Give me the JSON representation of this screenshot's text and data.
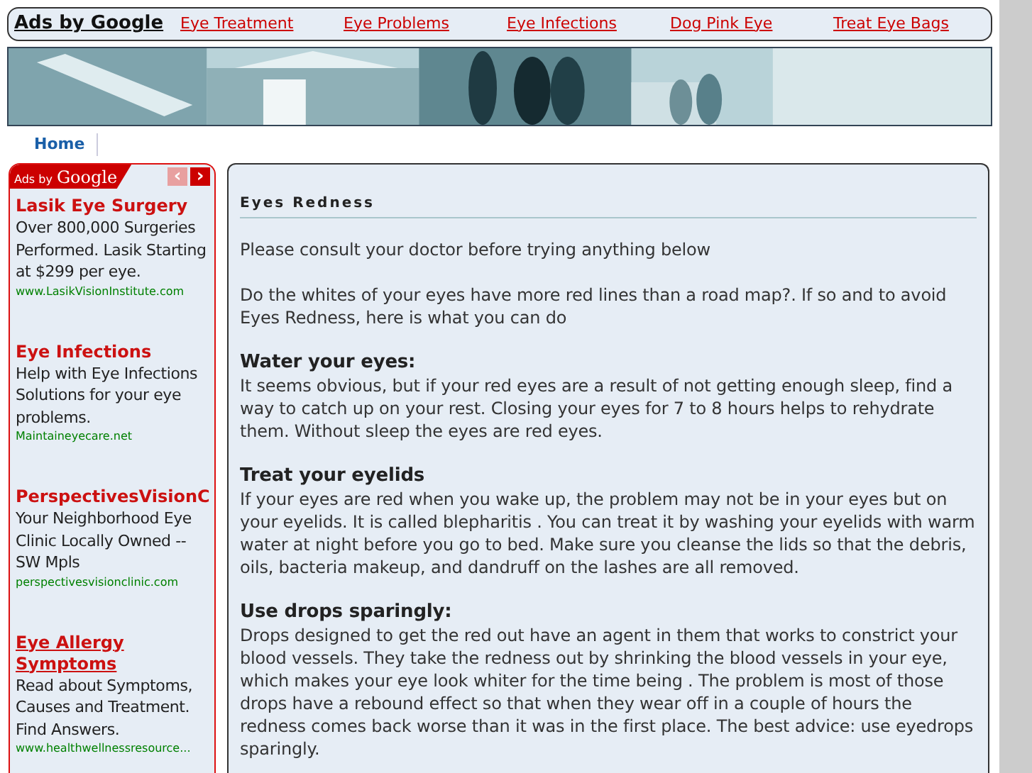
{
  "top_ads": {
    "label": "Ads by Google",
    "links": [
      "Eye Treatment",
      "Eye Problems",
      "Eye Infections",
      "Dog Pink Eye",
      "Treat Eye Bags"
    ]
  },
  "banner": {
    "kind": "picture"
  },
  "nav": [
    "Home"
  ],
  "side_ads": {
    "label_small": "Ads by",
    "label_big": "Google",
    "prev": {
      "label": "‹",
      "disabled": true
    },
    "next": {
      "label": "›",
      "disabled": false
    },
    "ads": [
      {
        "title": "Lasik Eye Surgery",
        "hovered": false,
        "text": "Over 800,000 Surgeries Performed. Lasik Starting at $299 per eye.",
        "url": "www.LasikVisionInstitute.com"
      },
      {
        "title": "Eye Infections",
        "hovered": false,
        "text": "Help with Eye Infections Solutions for your eye problems.",
        "url": "Maintaineyecare.net"
      },
      {
        "title": "PerspectivesVisionC",
        "hovered": false,
        "text": "Your Neighborhood Eye Clinic Locally Owned -- SW Mpls",
        "url": "perspectivesvisionclinic.com"
      },
      {
        "title": "Eye Allergy Symptoms",
        "hovered": true,
        "text": "Read about Symptoms, Causes and Treatment. Find Answers.",
        "url": "www.healthwellnessresource..."
      }
    ]
  },
  "article": {
    "title": "Eyes Redness",
    "intro": [
      "Please consult your doctor before trying anything below",
      "Do the whites of your eyes have more red lines than a road map?. If so and to avoid Eyes Redness, here is what you can do"
    ],
    "sections": [
      {
        "heading": "Water your eyes:",
        "text": "It seems obvious, but if your red eyes are a result of not getting enough sleep, find a way to catch up on your rest. Closing your eyes for 7 to 8 hours helps to rehydrate them. Without sleep the eyes are red eyes."
      },
      {
        "heading": "Treat your eyelids",
        "text": "If your eyes are red when you wake up, the problem may not be in your eyes but on your eyelids. It is called blepharitis . You can treat it by washing your eyelids with warm water at night before you go to bed. Make sure you cleanse the lids so that the debris, oils, bacteria makeup, and dandruff on the lashes are all removed."
      },
      {
        "heading": "Use drops sparingly:",
        "text": "Drops designed to get the red out have an agent in them that works to constrict your blood vessels. They take the redness out by shrinking the blood vessels in your eye, which makes your eye look whiter for the time being . The problem is most of those drops have a rebound effect so that when they wear off in a couple of hours the redness comes back worse than it was in the first place. The best advice: use eyedrops sparingly."
      }
    ]
  }
}
